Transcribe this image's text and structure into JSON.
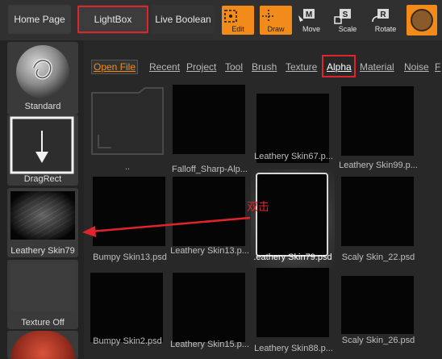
{
  "topbar": {
    "home_page": "Home Page",
    "lightbox": "LightBox",
    "live_boolean": "Live Boolean",
    "tools": [
      {
        "label": "Edit",
        "key": ""
      },
      {
        "label": "Draw",
        "key": ""
      },
      {
        "label": "Move",
        "key": "M"
      },
      {
        "label": "Scale",
        "key": "S"
      },
      {
        "label": "Rotate",
        "key": "R"
      }
    ]
  },
  "left_panel": {
    "items": [
      {
        "label": "Standard"
      },
      {
        "label": "DragRect"
      },
      {
        "label": "Leathery Skin79"
      },
      {
        "label": "Texture Off"
      }
    ]
  },
  "tabs": [
    "Open File",
    "Recent",
    "Project",
    "Tool",
    "Brush",
    "Texture",
    "Alpha",
    "Material",
    "Noise",
    "F"
  ],
  "grid": [
    {
      "label": ".."
    },
    {
      "label": "Falloff_Sharp-Alp..."
    },
    {
      "label": "Leathery Skin67.p..."
    },
    {
      "label": "Leathery Skin99.p..."
    },
    {
      "label": "Bumpy Skin13.psd"
    },
    {
      "label": "Leathery Skin13.p..."
    },
    {
      "label": ".eathery Skin79.psd"
    },
    {
      "label": "Scaly Skin_22.psd"
    },
    {
      "label": "Bumpy Skin2.psd"
    },
    {
      "label": "Leathery Skin15.p..."
    },
    {
      "label": "Leathery Skin88.p..."
    },
    {
      "label": "Scaly Skin_26.psd"
    }
  ],
  "annotation": {
    "text": "双击",
    "color": "#e0242b"
  },
  "colors": {
    "accent": "#f28b1a",
    "highlight": "#e0242b"
  }
}
